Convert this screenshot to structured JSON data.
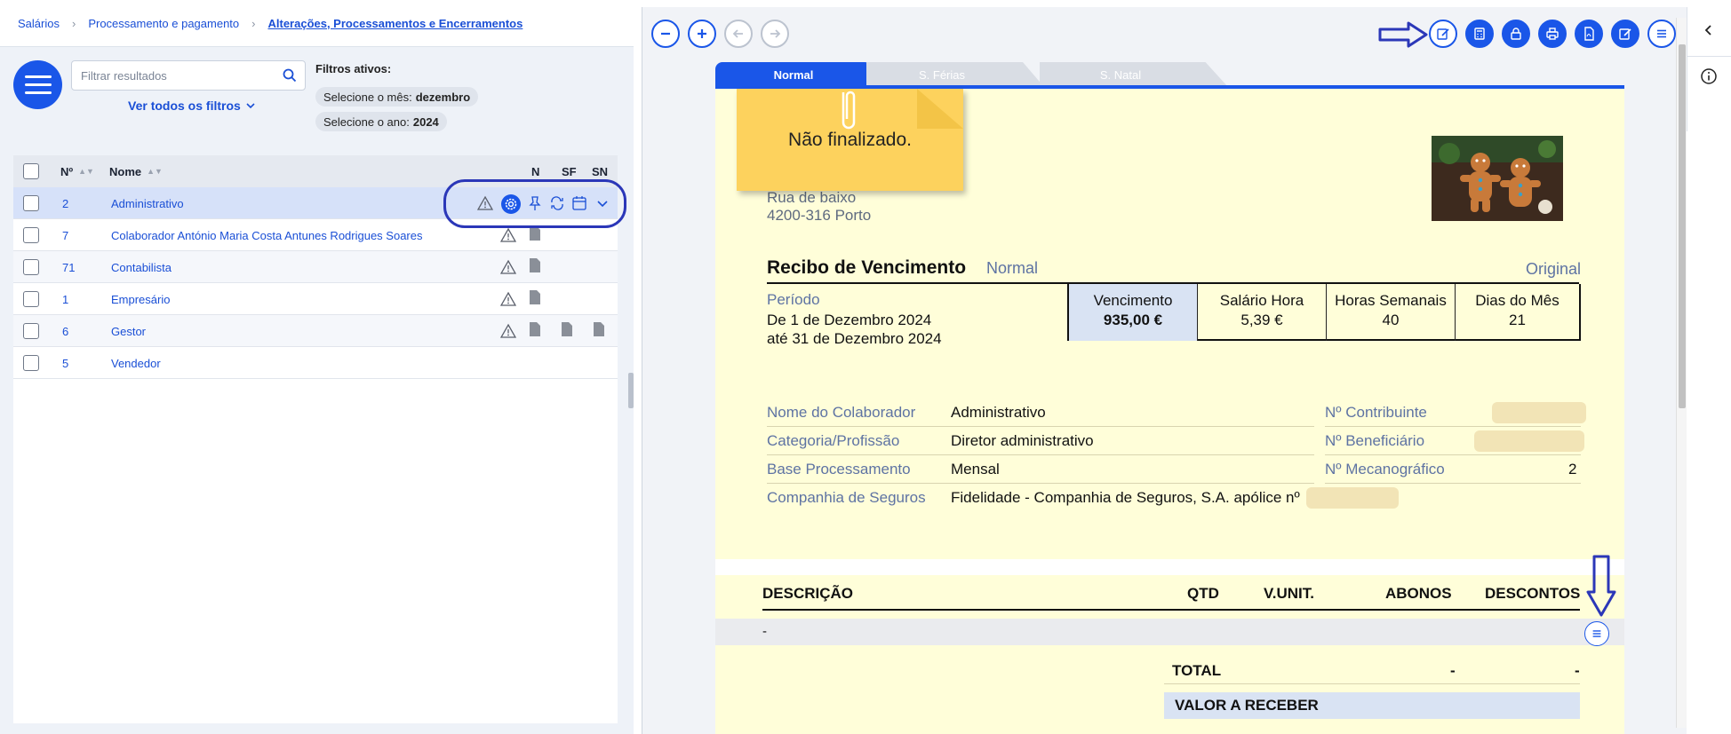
{
  "breadcrumb": {
    "items": [
      "Salários",
      "Processamento e pagamento",
      "Alterações, Processamentos e Encerramentos"
    ]
  },
  "left": {
    "search_placeholder": "Filtrar resultados",
    "see_all_filters": "Ver todos os filtros",
    "active_filters_title": "Filtros ativos:",
    "filters": [
      {
        "label": "Selecione o mês:",
        "value": "dezembro"
      },
      {
        "label": "Selecione o ano:",
        "value": "2024"
      }
    ],
    "columns": {
      "num": "Nº",
      "name": "Nome",
      "n": "N",
      "sf": "SF",
      "sn": "SN"
    },
    "rows": [
      {
        "num": "2",
        "name": "Administrativo"
      },
      {
        "num": "7",
        "name": "Colaborador António Maria Costa Antunes Rodrigues Soares"
      },
      {
        "num": "71",
        "name": "Contabilista"
      },
      {
        "num": "1",
        "name": "Empresário"
      },
      {
        "num": "6",
        "name": "Gestor"
      },
      {
        "num": "5",
        "name": "Vendedor"
      }
    ]
  },
  "viewer": {
    "tabs": [
      "Normal",
      "S. Férias",
      "S. Natal"
    ],
    "note": "Não finalizado.",
    "address_line1": "Rua de baixo",
    "address_line2": "4200-316 Porto",
    "title": "Recibo de Vencimento",
    "subtitle": "Normal",
    "copy": "Original",
    "period_label": "Período",
    "period_from": "De 1 de Dezembro 2024",
    "period_to": "até 31 de Dezembro 2024",
    "summary": [
      {
        "label": "Vencimento",
        "value": "935,00 €"
      },
      {
        "label": "Salário Hora",
        "value": "5,39 €"
      },
      {
        "label": "Horas Semanais",
        "value": "40"
      },
      {
        "label": "Dias do Mês",
        "value": "21"
      }
    ],
    "details": [
      {
        "label": "Nome do Colaborador",
        "value": "Administrativo"
      },
      {
        "label": "Categoria/Profissão",
        "value": "Diretor administrativo"
      },
      {
        "label": "Base Processamento",
        "value": "Mensal"
      },
      {
        "label": "Companhia de Seguros",
        "value": "Fidelidade - Companhia de Seguros, S.A. apólice nº"
      }
    ],
    "right_details": [
      {
        "label": "Nº Contribuinte",
        "value": ""
      },
      {
        "label": "Nº Beneficiário",
        "value": ""
      },
      {
        "label": "Nº Mecanográfico",
        "value": "2"
      }
    ],
    "lines_header": {
      "desc": "DESCRIÇÃO",
      "qty": "QTD",
      "unit": "V.UNIT.",
      "bonus": "ABONOS",
      "disc": "DESCONTOS"
    },
    "line_row": "-",
    "total_label": "TOTAL",
    "total_bonus": "-",
    "total_disc": "-",
    "net_label": "VALOR A RECEBER"
  },
  "colors": {
    "accent": "#1a56e8",
    "annotation": "#2b37b8",
    "doc_bg": "#fffed9",
    "note": "#fdd25d"
  }
}
